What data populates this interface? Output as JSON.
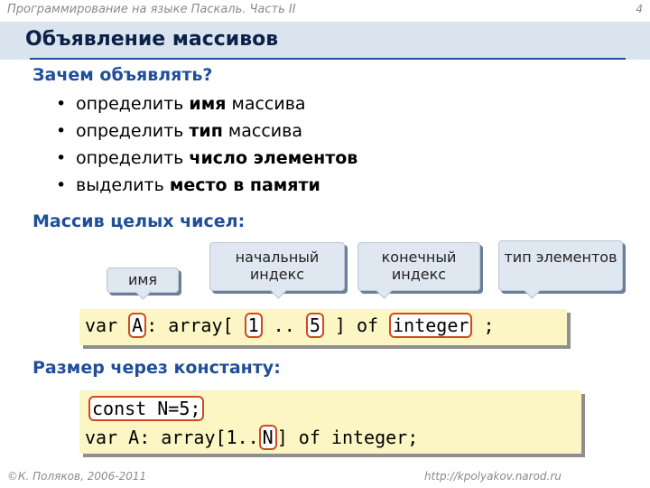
{
  "header": {
    "course": "Программирование на языке Паскаль. Часть II",
    "page_number": "4"
  },
  "title": "Объявление массивов",
  "why": {
    "heading": "Зачем объявлять?",
    "items": [
      {
        "prefix": "определить ",
        "bold": "имя",
        "suffix": " массива"
      },
      {
        "prefix": "определить ",
        "bold": "тип",
        "suffix": " массива"
      },
      {
        "prefix": "определить ",
        "bold": "число элементов",
        "suffix": ""
      },
      {
        "prefix": "выделить ",
        "bold": "место в памяти",
        "suffix": ""
      }
    ]
  },
  "int_array": {
    "heading": "Массив целых чисел:",
    "callouts": {
      "name": "имя",
      "start_index": "начальный индекс",
      "end_index": "конечный индекс",
      "elem_type": "тип элементов"
    },
    "code": {
      "kw_var": "var ",
      "name": "A",
      "mid1": ": array[ ",
      "start": "1",
      "dots": " .. ",
      "end": "5",
      "mid2": " ] of ",
      "type": "integer",
      "semi": " ;"
    }
  },
  "const_size": {
    "heading": "Размер через константу:",
    "code": {
      "line1": "const N=5;",
      "line2_pre": "var A: array[1..",
      "line2_n": "N",
      "line2_post": "] of integer;"
    }
  },
  "footer": {
    "left": "©К. Поляков, 2006-2011",
    "right": "http://kpolyakov.narod.ru"
  },
  "colors": {
    "accent": "#1f4e9a",
    "title_band": "#d9e4ef",
    "code_bg": "#fbf6c4",
    "highlight_border": "#d04a1c"
  }
}
